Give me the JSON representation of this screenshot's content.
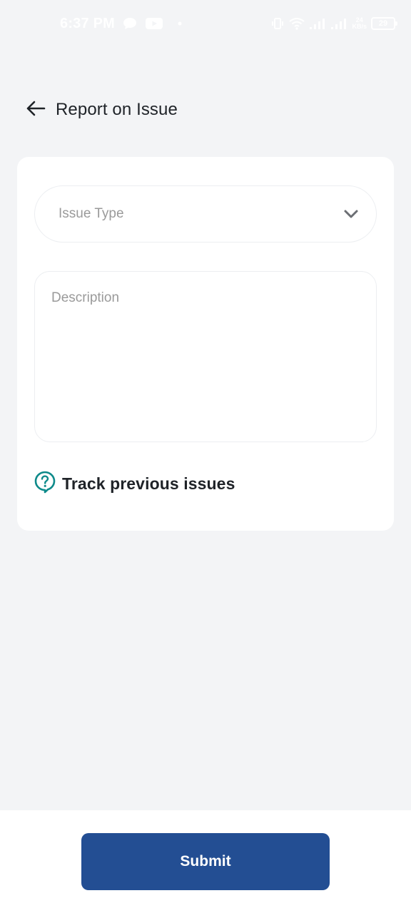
{
  "status_bar": {
    "time": "6:37 PM",
    "network_top": "24",
    "network_bottom": "KB/s",
    "battery": "29"
  },
  "header": {
    "back_icon": "arrow-left-icon",
    "title": "Report on Issue"
  },
  "form": {
    "issue_type_placeholder": "Issue Type",
    "dropdown_icon": "chevron-down-icon",
    "description_placeholder": "Description",
    "track_icon": "question-bubble-icon",
    "track_label": "Track previous issues"
  },
  "footer": {
    "submit_label": "Submit"
  },
  "colors": {
    "background": "#f3f4f6",
    "card": "#ffffff",
    "primary": "#234e93",
    "accent_teal": "#0e8a8a",
    "placeholder": "#9a9a9a"
  }
}
